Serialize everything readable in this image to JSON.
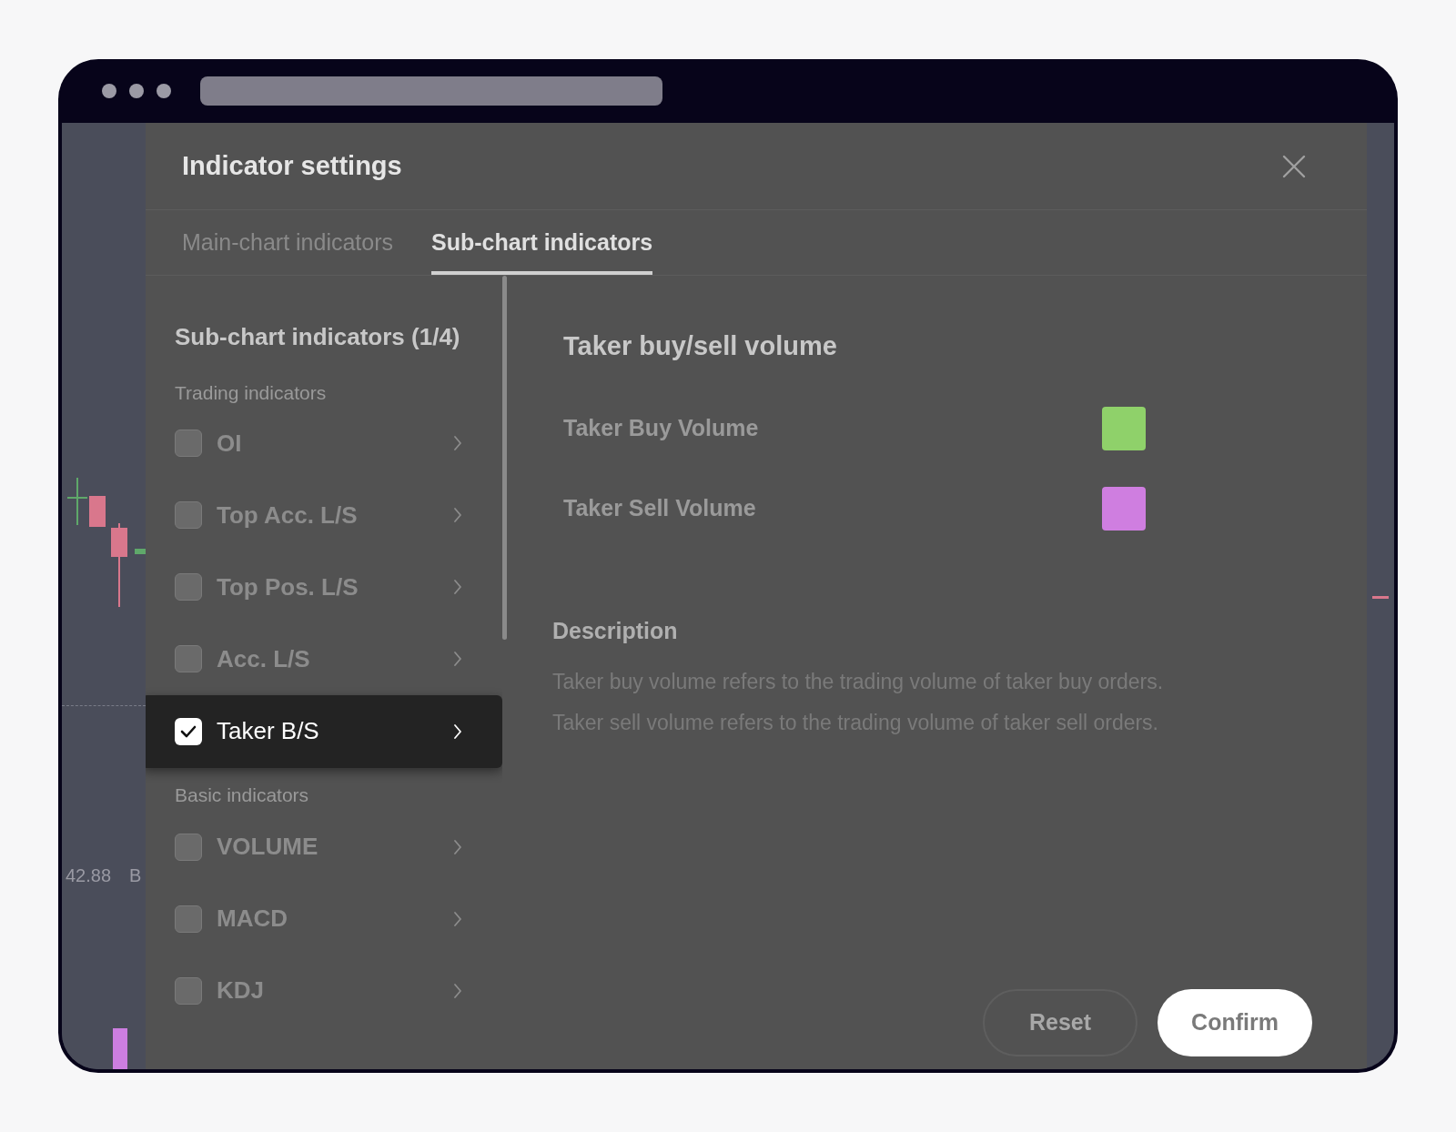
{
  "dialog": {
    "title": "Indicator settings"
  },
  "tabs": [
    {
      "label": "Main-chart indicators",
      "selected": false
    },
    {
      "label": "Sub-chart indicators",
      "selected": true
    }
  ],
  "sidebar": {
    "heading": "Sub-chart indicators (1/4)",
    "sections": [
      {
        "title": "Trading indicators",
        "items": [
          {
            "label": "OI",
            "checked": false,
            "selected": false
          },
          {
            "label": "Top Acc. L/S",
            "checked": false,
            "selected": false
          },
          {
            "label": "Top Pos. L/S",
            "checked": false,
            "selected": false
          },
          {
            "label": "Acc. L/S",
            "checked": false,
            "selected": false
          },
          {
            "label": "Taker B/S",
            "checked": true,
            "selected": true
          }
        ]
      },
      {
        "title": "Basic indicators",
        "items": [
          {
            "label": "VOLUME",
            "checked": false,
            "selected": false
          },
          {
            "label": "MACD",
            "checked": false,
            "selected": false
          },
          {
            "label": "KDJ",
            "checked": false,
            "selected": false
          }
        ]
      }
    ]
  },
  "detail": {
    "title": "Taker buy/sell volume",
    "series": [
      {
        "label": "Taker Buy Volume",
        "color": "#8fd16a"
      },
      {
        "label": "Taker Sell Volume",
        "color": "#cf7ee0"
      }
    ],
    "description_title": "Description",
    "description": [
      "Taker buy volume refers to the trading volume of taker buy orders.",
      "Taker sell volume refers to the trading volume of taker sell orders."
    ]
  },
  "buttons": [
    {
      "label": "Reset",
      "kind": "secondary"
    },
    {
      "label": "Confirm",
      "kind": "primary"
    }
  ],
  "background_chart": {
    "value_label": "42.88",
    "unit_label": "B"
  }
}
